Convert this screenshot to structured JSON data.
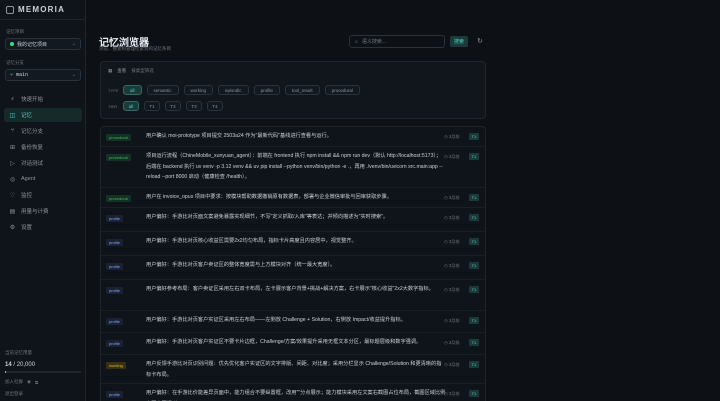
{
  "app": {
    "name": "MEMORIA"
  },
  "sidebar": {
    "project_label": "记忆项目",
    "project_value": "我的记忆项目",
    "branch_label": "记忆分支",
    "branch_value": "main",
    "nav": [
      {
        "icon": "⚡",
        "icon_name": "bolt-icon",
        "label": "快速开始",
        "key": "quickstart"
      },
      {
        "icon": "◫",
        "icon_name": "memory-icon",
        "label": "记忆",
        "key": "memory",
        "active": true
      },
      {
        "icon": "⑂",
        "icon_name": "branch-icon",
        "label": "记忆分支",
        "key": "branches"
      },
      {
        "icon": "⊞",
        "icon_name": "backup-icon",
        "label": "备份恢复",
        "key": "backup"
      },
      {
        "icon": "▷",
        "icon_name": "chat-icon",
        "label": "对话测试",
        "key": "chat"
      },
      {
        "icon": "◎",
        "icon_name": "agent-icon",
        "label": "Agent",
        "key": "agent"
      },
      {
        "icon": "♡",
        "icon_name": "monitor-icon",
        "label": "监控",
        "key": "monitor"
      },
      {
        "icon": "▤",
        "icon_name": "usage-icon",
        "label": "用量与计费",
        "key": "usage"
      },
      {
        "icon": "⚙",
        "icon_name": "gear-icon",
        "label": "设置",
        "key": "settings"
      }
    ],
    "quota_label": "当前记忆用量",
    "quota_used": "14",
    "quota_total": "/ 20,000",
    "quota_fraction": 0.0007,
    "footer_row1": "加入社群",
    "footer_row2": "退出登录"
  },
  "page": {
    "title": "记忆浏览器",
    "subtitle": "浏览、搜索和管理检索到的记忆条目",
    "search_placeholder": "语义搜索...",
    "search_button": "搜索",
    "refresh_icon": "↻"
  },
  "filters": {
    "scope_label": "查看",
    "scope_hint": "按类型筛选",
    "type_label": "TYPE",
    "tier_label": "TIER",
    "types": [
      {
        "label": "all",
        "active": true
      },
      {
        "label": "semantic"
      },
      {
        "label": "working"
      },
      {
        "label": "episodic"
      },
      {
        "label": "profile"
      },
      {
        "label": "tool_result"
      },
      {
        "label": "procedural"
      }
    ],
    "tiers": [
      {
        "label": "all",
        "active": true
      },
      {
        "label": "T1"
      },
      {
        "label": "T2"
      },
      {
        "label": "T3"
      },
      {
        "label": "T4"
      }
    ]
  },
  "type_colors": {
    "procedural": {
      "bg": "#143126",
      "fg": "#3fb950"
    },
    "profile": {
      "bg": "#1a2133",
      "fg": "#8ea3ff"
    },
    "working": {
      "bg": "#3a3010",
      "fg": "#e3b341"
    }
  },
  "memories": [
    {
      "type": "procedural",
      "text": "用户确认 moi-prototype 项目提交 2503a24 作为\"最新代码\"基线进行查看与运行。",
      "date": "3月前",
      "tier": "T1"
    },
    {
      "type": "procedural",
      "text": "项目运行流程（ChineMobile_xunyuan_agent）：前端在 frontend 执行 npm install && npm run dev（默认 http://localhost:5173）；后端在 backend 执行 uv venv -p 3.12 venv && uv pip install --python venv/bin/python -e .，再用 ./venv/bin/uvicorn src.main:app --reload --port 8000 启动（健康检查 /health）。",
      "date": "3月前",
      "tier": "T1"
    },
    {
      "type": "procedural",
      "text": "用户在 invoice_opus 项目中要求：按模块帮助数据撤销原有数据表，部署与企业微信审批与回审获取步骤。",
      "date": "3月前",
      "tier": "T1"
    },
    {
      "type": "profile",
      "text": "用户偏好：手游比对页面文案避免暴露实现细节，不写\"定义抓取/入库\"等表达；并倾向描述为\"实时搜索\"。",
      "date": "3月前",
      "tier": "T1"
    },
    {
      "type": "profile",
      "text": "用户偏好：手游比对页核心收益区需要2x2均匀布局，指标卡片高度且内容居中，视觉整齐。",
      "date": "3月前",
      "tier": "T1"
    },
    {
      "type": "profile",
      "text": "用户偏好：手游比对页客户卖证区的整体宽度需与上方模块对齐（统一最大宽度）。",
      "date": "3月前",
      "tier": "T1"
    },
    {
      "type": "profile",
      "text": "用户偏好参考布局：客户卖证区采用左右双卡布局，左卡展示客户背景+挑战+解决方案，右卡展示\"核心收益\"2x2大数字指标。",
      "date": "3月前",
      "tier": "T1"
    },
    {
      "type": "profile",
      "text": "用户偏好：手游比对页客户实证区采用左右布局——左侧放 Challenge + Solution，右侧放 Impact/收益提升指标。",
      "date": "3月前",
      "tier": "T1"
    },
    {
      "type": "profile",
      "text": "用户偏好：手游比对页客户实证区不要卡片边框，Challenge/方案/效果提升采用无框文本分区，最标题层级和数字强调。",
      "date": "3月前",
      "tier": "T1"
    },
    {
      "type": "working",
      "text": "用户反馈手游比对页识别问题：优先优化客户实证区的文字排版、间距、对比度；采用分栏显示 Challenge/Solution 和更清晰的指标卡布局。",
      "date": "3月前",
      "tier": "T1"
    },
    {
      "type": "profile",
      "text": "用户偏好：在手游比价能差异页面中，能力组合不要纵置框，改用\"\"分点展示；能力模块采用左文案右截图占位布局，截图区域比例应更宽更清晰。",
      "date": "3月前",
      "tier": "T1"
    }
  ]
}
